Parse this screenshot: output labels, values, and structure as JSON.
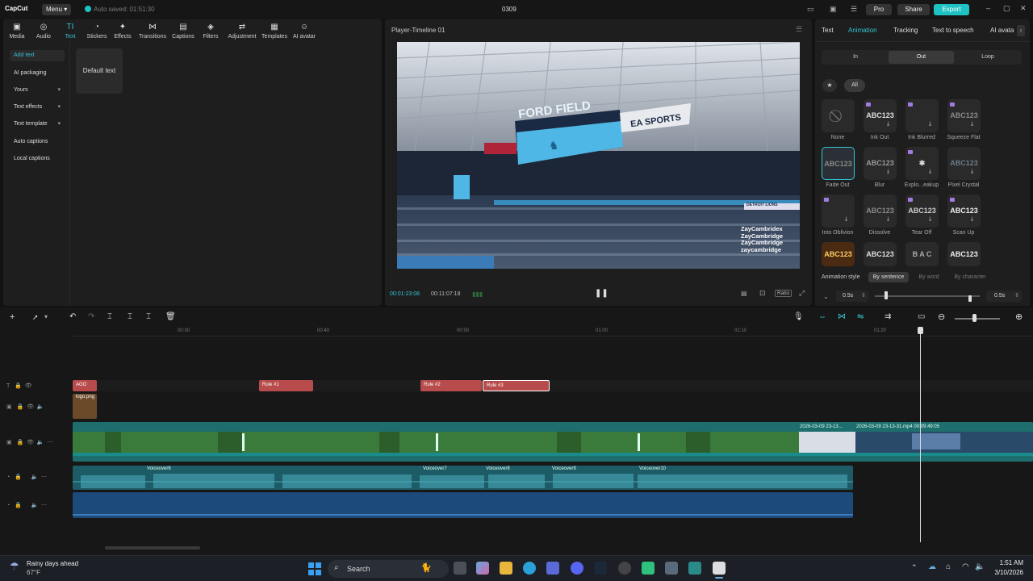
{
  "app": {
    "logo": "CapCut",
    "menu_label": "Menu",
    "autosave": "Auto saved: 01:51:30",
    "project_title": "0309",
    "pro_label": "Pro",
    "share_label": "Share",
    "export_label": "Export"
  },
  "toolbar": [
    {
      "label": "Media",
      "icon": "media-icon"
    },
    {
      "label": "Audio",
      "icon": "audio-icon"
    },
    {
      "label": "Text",
      "icon": "text-icon",
      "active": true
    },
    {
      "label": "Stickers",
      "icon": "stickers-icon"
    },
    {
      "label": "Effects",
      "icon": "effects-icon"
    },
    {
      "label": "Transitions",
      "icon": "transitions-icon"
    },
    {
      "label": "Captions",
      "icon": "captions-icon"
    },
    {
      "label": "Filters",
      "icon": "filters-icon"
    },
    {
      "label": "Adjustment",
      "icon": "adjustment-icon"
    },
    {
      "label": "Templates",
      "icon": "templates-icon"
    },
    {
      "label": "AI avatar",
      "icon": "ai-avatar-icon"
    }
  ],
  "sidebar": {
    "add_text": "Add text",
    "ai_packaging": "AI packaging",
    "yours": "Yours",
    "text_effects": "Text effects",
    "text_template": "Text template",
    "auto_captions": "Auto captions",
    "local_captions": "Local captions"
  },
  "default_text": "Default text",
  "player": {
    "title": "Player-Timeline 01",
    "current_time": "00:01:23:08",
    "total_time": "00:11:07:18",
    "ratio_label": "Ratio",
    "stadium_text": "FORD FIELD",
    "sponsor_text": "EA SPORTS",
    "stadium_side_text": "DETROIT LIONS",
    "credits": [
      "ZayCambridex",
      "ZayCambridge",
      "ZayCambridge",
      "zaycambridge"
    ]
  },
  "right_panel": {
    "tabs": [
      "Text",
      "Animation",
      "Tracking",
      "Text to speech",
      "AI avata"
    ],
    "active_tab": "Animation",
    "segments": [
      "In",
      "Out",
      "Loop"
    ],
    "active_segment": "Out",
    "filter_all": "All",
    "sample_text": "ABC123",
    "presets": [
      "None",
      "Ink Out",
      "Ink Blurred",
      "Squeeze Flat",
      "Fade Out",
      "Blur",
      "Explo...eakup",
      "Pixel Crystal",
      "Into Oblivion",
      "Dissolve",
      "Tear Off",
      "Scan Up"
    ],
    "anim_style_label": "Animation style",
    "anim_style_options": [
      "By sentence",
      "By word",
      "By character"
    ],
    "duration_left": "0.5s",
    "duration_right": "0.5s",
    "accent": "#35c3d2"
  },
  "timeline": {
    "ruler": [
      "00:30",
      "00:40",
      "00:50",
      "01:00",
      "01:10",
      "01:20"
    ],
    "text_clips": [
      "AGO",
      "Rule #1",
      "Rule #2",
      "Rule #3"
    ],
    "sticker_clip": "logo.png",
    "video_clip_1": "2026-03-09 23-13...",
    "video_clip_2": "2026-03-09 23-13-31.mp4  00:09:49:05",
    "voiceovers": [
      "Voiceover6",
      "Voiceover7",
      "Voiceover8",
      "Voiceover9",
      "Voiceover10"
    ]
  },
  "taskbar": {
    "weather_title": "Rainy days ahead",
    "weather_temp": "67°F",
    "search_placeholder": "Search",
    "time": "1:51 AM",
    "date": "3/10/2026"
  }
}
